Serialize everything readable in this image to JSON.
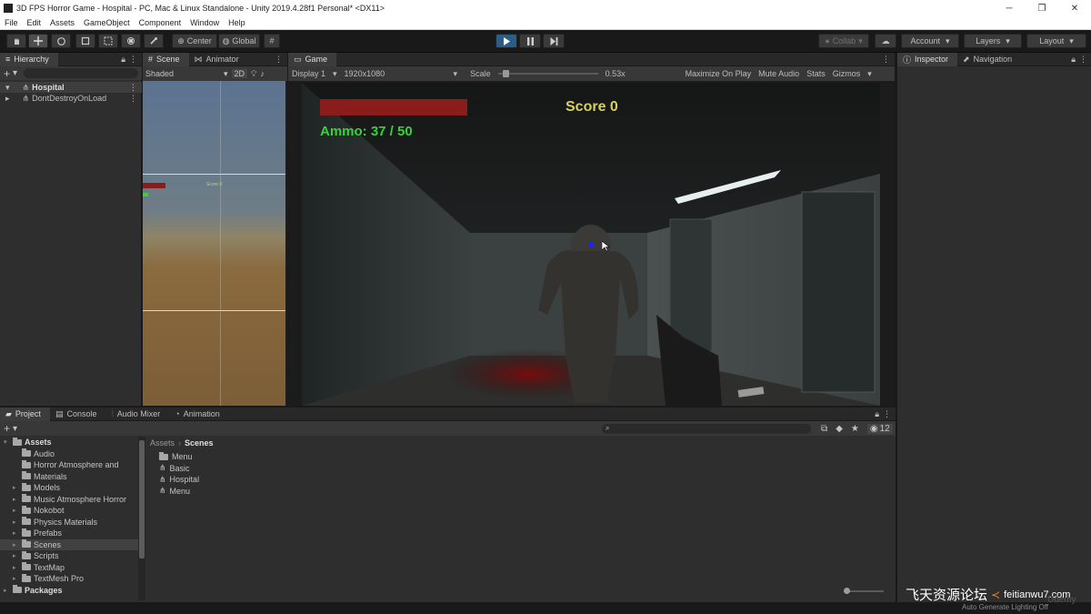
{
  "window": {
    "title": "3D FPS Horror Game - Hospital - PC, Mac & Linux Standalone - Unity 2019.4.28f1 Personal* <DX11>",
    "controls": [
      "─",
      "❐",
      "✕"
    ]
  },
  "menu": [
    "File",
    "Edit",
    "Assets",
    "GameObject",
    "Component",
    "Window",
    "Help"
  ],
  "toolbar": {
    "pivot_label": "Center",
    "space_label": "Global",
    "collab_label": "Collab",
    "account_label": "Account",
    "layers_label": "Layers",
    "layout_label": "Layout"
  },
  "hierarchy": {
    "tab_label": "Hierarchy",
    "items": [
      {
        "label": "Hospital",
        "selected": true
      },
      {
        "label": "DontDestroyOnLoad",
        "selected": false
      }
    ]
  },
  "scene": {
    "tabs": [
      "Scene",
      "Animator"
    ],
    "shading_mode": "Shaded",
    "mode_2d": "2D",
    "mini_score": "Score 0"
  },
  "game": {
    "tab_label": "Game",
    "display": "Display 1",
    "resolution": "1920x1080",
    "scale_label": "Scale",
    "scale_value": "0.53x",
    "scale_fraction": 0.05,
    "options": [
      "Maximize On Play",
      "Mute Audio",
      "Stats",
      "Gizmos"
    ],
    "hud": {
      "score": "Score 0",
      "ammo": "Ammo: 37 / 50",
      "health_fraction": 1.0,
      "health_color": "#8a1c1c",
      "score_color": "#d8d05a",
      "ammo_color": "#3ecf3a"
    }
  },
  "inspector": {
    "tabs": [
      "Inspector",
      "Navigation"
    ]
  },
  "project": {
    "tabs": [
      "Project",
      "Console",
      "Audio Mixer",
      "Animation"
    ],
    "search_placeholder": "",
    "hidden_count": "12",
    "breadcrumb": [
      "Assets",
      "Scenes"
    ],
    "tree": [
      {
        "label": "Assets",
        "level": 0,
        "bold": true
      },
      {
        "label": "Audio",
        "level": 1
      },
      {
        "label": "Horror Atmosphere and",
        "level": 1
      },
      {
        "label": "Materials",
        "level": 1
      },
      {
        "label": "Models",
        "level": 1
      },
      {
        "label": "Music Atmosphere Horror",
        "level": 1
      },
      {
        "label": "Nokobot",
        "level": 1
      },
      {
        "label": "Physics Materials",
        "level": 1
      },
      {
        "label": "Prefabs",
        "level": 1
      },
      {
        "label": "Scenes",
        "level": 1,
        "selected": true
      },
      {
        "label": "Scripts",
        "level": 1
      },
      {
        "label": "TextMap",
        "level": 1
      },
      {
        "label": "TextMesh Pro",
        "level": 1
      },
      {
        "label": "Packages",
        "level": 0,
        "bold": true
      }
    ],
    "files": [
      {
        "label": "Menu",
        "kind": "folder"
      },
      {
        "label": "Basic",
        "kind": "scene"
      },
      {
        "label": "Hospital",
        "kind": "scene"
      },
      {
        "label": "Menu",
        "kind": "scene"
      }
    ]
  },
  "status": {
    "text": "Auto Generate Lighting Off",
    "watermark": "飞天资源论坛",
    "watermark_site": "feitianwu7.com",
    "brand": "Udemy"
  }
}
